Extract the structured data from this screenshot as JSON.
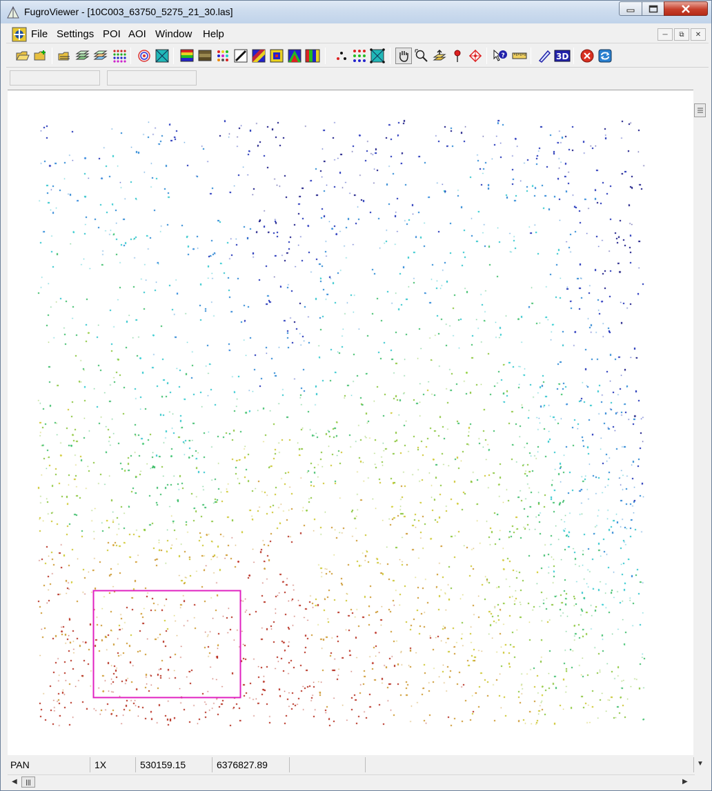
{
  "window": {
    "title": "FugroViewer - [10C003_63750_5275_21_30.las]"
  },
  "menu": {
    "items": [
      "File",
      "Settings",
      "POI",
      "AOI",
      "Window",
      "Help"
    ]
  },
  "toolbar": {
    "icons": [
      "open-folder-icon",
      "add-file-icon",
      "open-layer-icon",
      "layers-icon",
      "layers-color-icon",
      "point-grid-icon",
      "contour-icon",
      "tin-surface-icon",
      "elevation-ramp-icon",
      "intensity-ramp-icon",
      "class-color-icon",
      "profile-line-icon",
      "rgb-color-icon",
      "shaded-relief-icon",
      "gradient-icon",
      "color-bars-icon",
      "point-display-icon",
      "point-grid-display-icon",
      "surface-display-icon",
      "pan-hand-icon",
      "zoom-icon",
      "profile-tool-icon",
      "poi-pin-icon",
      "target-icon",
      "query-icon",
      "ruler-icon",
      "measure-icon",
      "3d-view-icon",
      "stop-icon",
      "refresh-icon"
    ]
  },
  "statusbar": {
    "mode": "PAN",
    "zoom": "1X",
    "x_coord": "530159.15",
    "y_coord": "6376827.89"
  },
  "colors": {
    "aoi_rectangle": "#e020c0",
    "point_ramp": [
      "#00007a",
      "#0a1fb0",
      "#1a7fd0",
      "#20c0c8",
      "#30b860",
      "#80c030",
      "#c8c020",
      "#c89020",
      "#b02010"
    ]
  }
}
